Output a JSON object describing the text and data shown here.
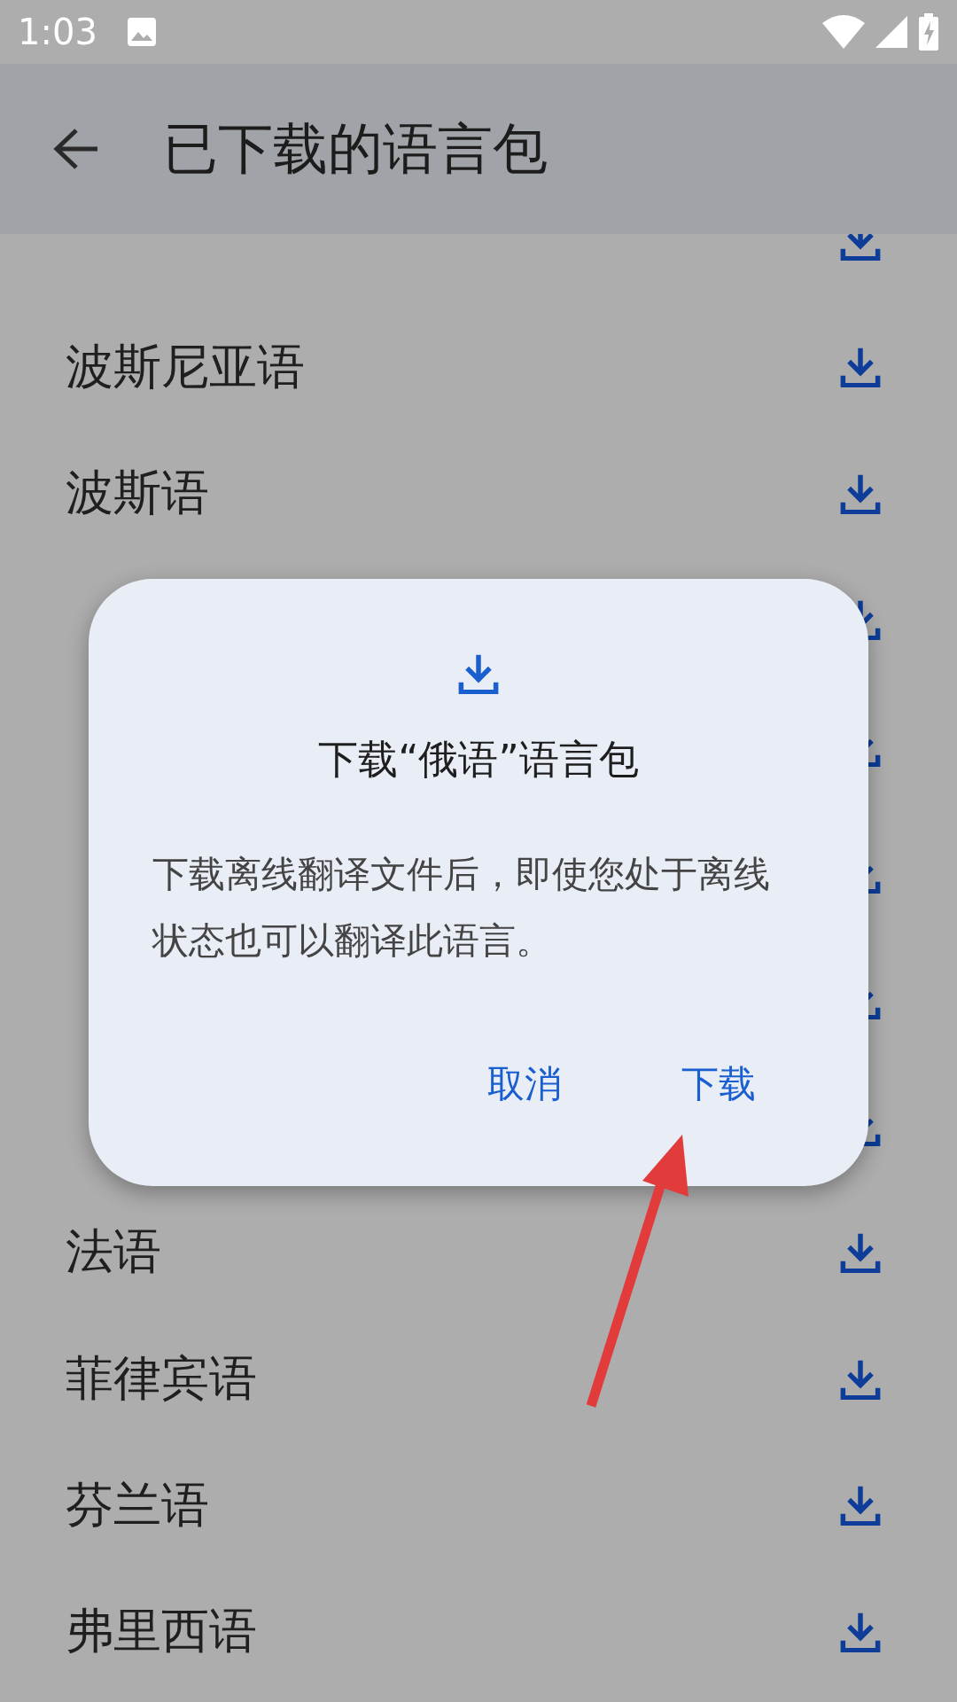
{
  "status_bar": {
    "time": "1:03"
  },
  "app_bar": {
    "title": "已下载的语言包"
  },
  "languages": [
    {
      "kind": "covered"
    },
    {
      "kind": "language",
      "name": "波斯尼亚语"
    },
    {
      "kind": "language",
      "name": "波斯语"
    },
    {
      "kind": "covered"
    },
    {
      "kind": "covered"
    },
    {
      "kind": "covered"
    },
    {
      "kind": "covered"
    },
    {
      "kind": "covered"
    },
    {
      "kind": "language",
      "name": "法语"
    },
    {
      "kind": "language",
      "name": "菲律宾语"
    },
    {
      "kind": "language",
      "name": "芬兰语"
    },
    {
      "kind": "language",
      "name": "弗里西语"
    }
  ],
  "dialog": {
    "title": "下载“俄语”语言包",
    "message": "下载离线翻译文件后，即使您处于离线状态也可以翻译此语言。",
    "buttons": [
      {
        "label": "取消"
      },
      {
        "label": "下载"
      }
    ]
  }
}
